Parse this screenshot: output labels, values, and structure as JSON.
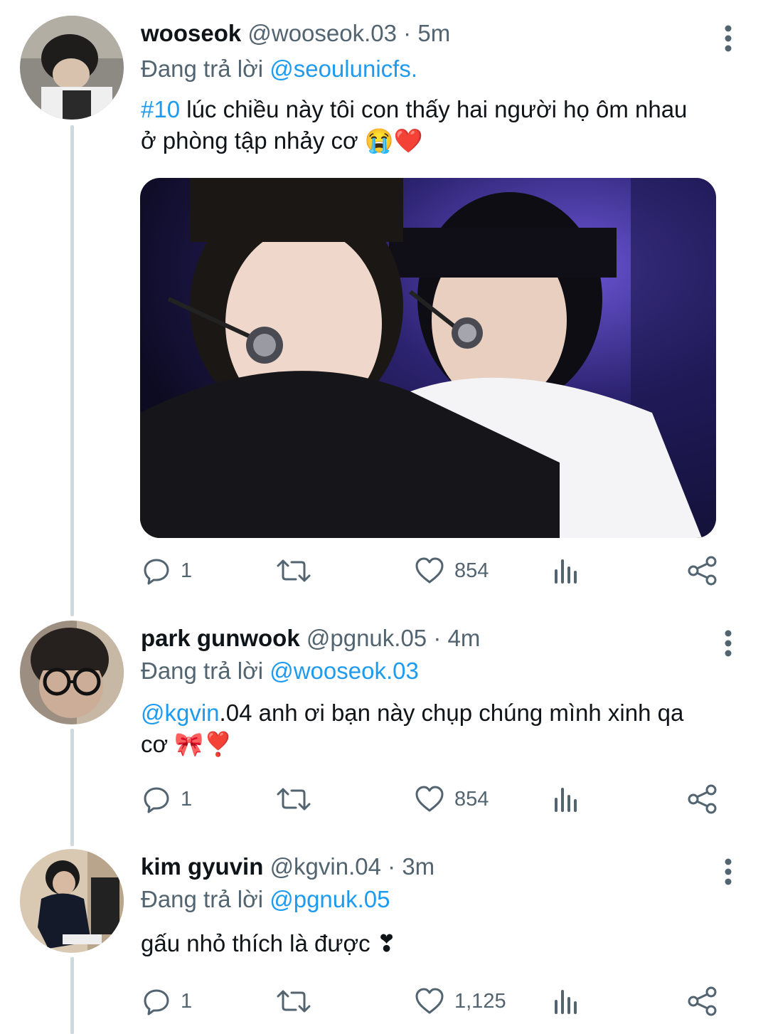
{
  "tweets": [
    {
      "name": "wooseok",
      "handle": "@wooseok.03",
      "sep": "·",
      "time": "5m",
      "reply_prefix": "Đang trả lời",
      "reply_to": "@seoulunicfs.",
      "text_link": "#10",
      "text_line1": " lúc chiều này tôi con thấy hai người họ ôm nhau",
      "text_line2": "ở phòng tập nhảy cơ 😭❤️",
      "has_media": true,
      "replies": "1",
      "likes": "854"
    },
    {
      "name": "park gunwook",
      "handle": "@pgnuk.05",
      "sep": "·",
      "time": "4m",
      "reply_prefix": "Đang trả lời",
      "reply_to": "@wooseok.03",
      "text_link": "@kgvin",
      "text_line1": ".04 anh ơi bạn này chụp chúng mình xinh qa",
      "text_line2": "cơ 🎀❣️",
      "replies": "1",
      "likes": "854"
    },
    {
      "name": "kim gyuvin",
      "handle": "@kgvin.04",
      "sep": "·",
      "time": "3m",
      "reply_prefix": "Đang trả lời",
      "reply_to": "@pgnuk.05",
      "text_line1": "gấu nhỏ thích là được ❣",
      "replies": "1",
      "likes": "1,125"
    }
  ],
  "icons": [
    "more-vertical-icon",
    "reply-icon",
    "retweet-icon",
    "like-icon",
    "views-icon",
    "share-icon"
  ],
  "colors": {
    "link": "#1d9bf0",
    "secondary": "#536471",
    "text": "#0f1419",
    "thread_line": "#cfd9de"
  }
}
